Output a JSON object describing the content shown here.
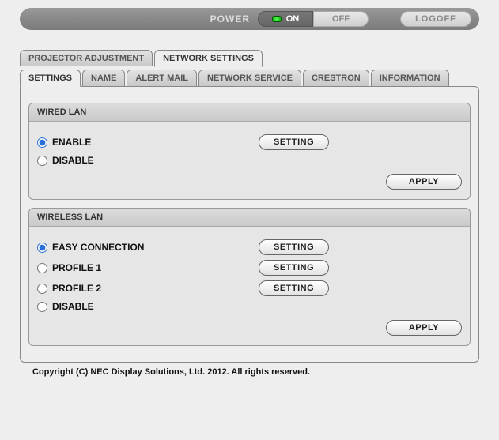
{
  "header": {
    "power_label": "POWER",
    "on_label": "ON",
    "off_label": "OFF",
    "logoff_label": "LOGOFF"
  },
  "main_tabs": {
    "projector_adjustment": "PROJECTOR ADJUSTMENT",
    "network_settings": "NETWORK SETTINGS"
  },
  "sub_tabs": {
    "settings": "SETTINGS",
    "name": "NAME",
    "alert_mail": "ALERT MAIL",
    "network_service": "NETWORK SERVICE",
    "crestron": "CRESTRON",
    "information": "INFORMATION"
  },
  "wired_lan": {
    "title": "WIRED LAN",
    "enable": "ENABLE",
    "disable": "DISABLE",
    "setting_btn": "SETTING",
    "apply_btn": "APPLY",
    "selected": "enable"
  },
  "wireless_lan": {
    "title": "WIRELESS LAN",
    "easy_connection": "EASY CONNECTION",
    "profile1": "PROFILE 1",
    "profile2": "PROFILE 2",
    "disable": "DISABLE",
    "setting_btn": "SETTING",
    "apply_btn": "APPLY",
    "selected": "easy_connection"
  },
  "footer": {
    "copyright": "Copyright (C) NEC Display Solutions, Ltd. 2012. All rights reserved."
  }
}
